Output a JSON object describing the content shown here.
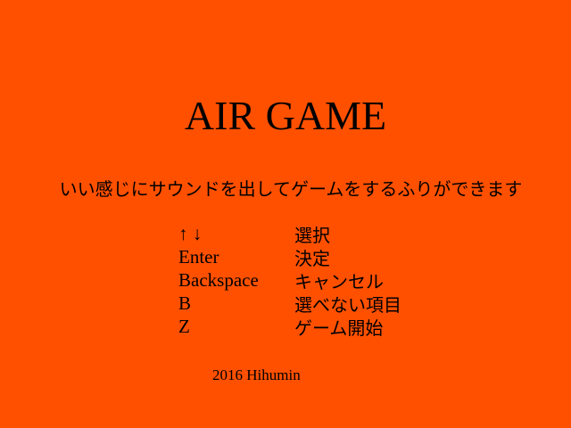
{
  "screen": {
    "background": "#ff5000",
    "text_color": "#000000"
  },
  "title": "AIR GAME",
  "tagline": "いい感じにサウンドを出してゲームをするふりができます",
  "controls": [
    {
      "key": "↑ ↓",
      "action": "選択"
    },
    {
      "key": "Enter",
      "action": "決定"
    },
    {
      "key": "Backspace",
      "action": "キャンセル"
    },
    {
      "key": "B",
      "action": "選べない項目"
    },
    {
      "key": "Z",
      "action": "ゲーム開始"
    }
  ],
  "credit": "2016 Hihumin"
}
